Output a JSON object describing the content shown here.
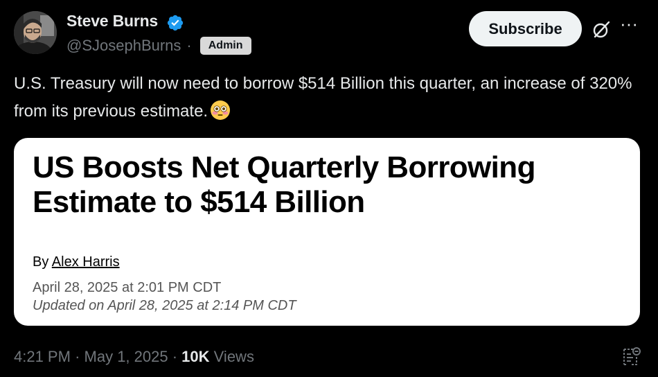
{
  "post": {
    "author_name": "Steve Burns",
    "handle": "@SJosephBurns",
    "separator": "·",
    "badge": "Admin",
    "subscribe_label": "Subscribe",
    "more_label": "···",
    "text": "U.S. Treasury will now need to borrow $514 Billion this quarter, an increase of 320% from its previous estimate.",
    "emoji": "flushed-face-emoji",
    "time": "4:21 PM",
    "date": "May 1, 2025",
    "views_count": "10K",
    "views_label": "Views"
  },
  "card": {
    "headline": "US Boosts Net Quarterly Borrowing Estimate to $514 Billion",
    "by_label": "By",
    "author": "Alex Harris",
    "published": "April 28, 2025 at 2:01 PM CDT",
    "updated": "Updated on April 28, 2025 at 2:14 PM CDT"
  },
  "colors": {
    "background": "#000000",
    "text_primary": "#e7e9ea",
    "text_secondary": "#71767b",
    "verified_blue": "#1d9bf0",
    "card_background": "#ffffff"
  },
  "icons": [
    "verified-icon",
    "grok-icon",
    "more-icon",
    "bookmark-icon",
    "flushed-face-emoji"
  ]
}
